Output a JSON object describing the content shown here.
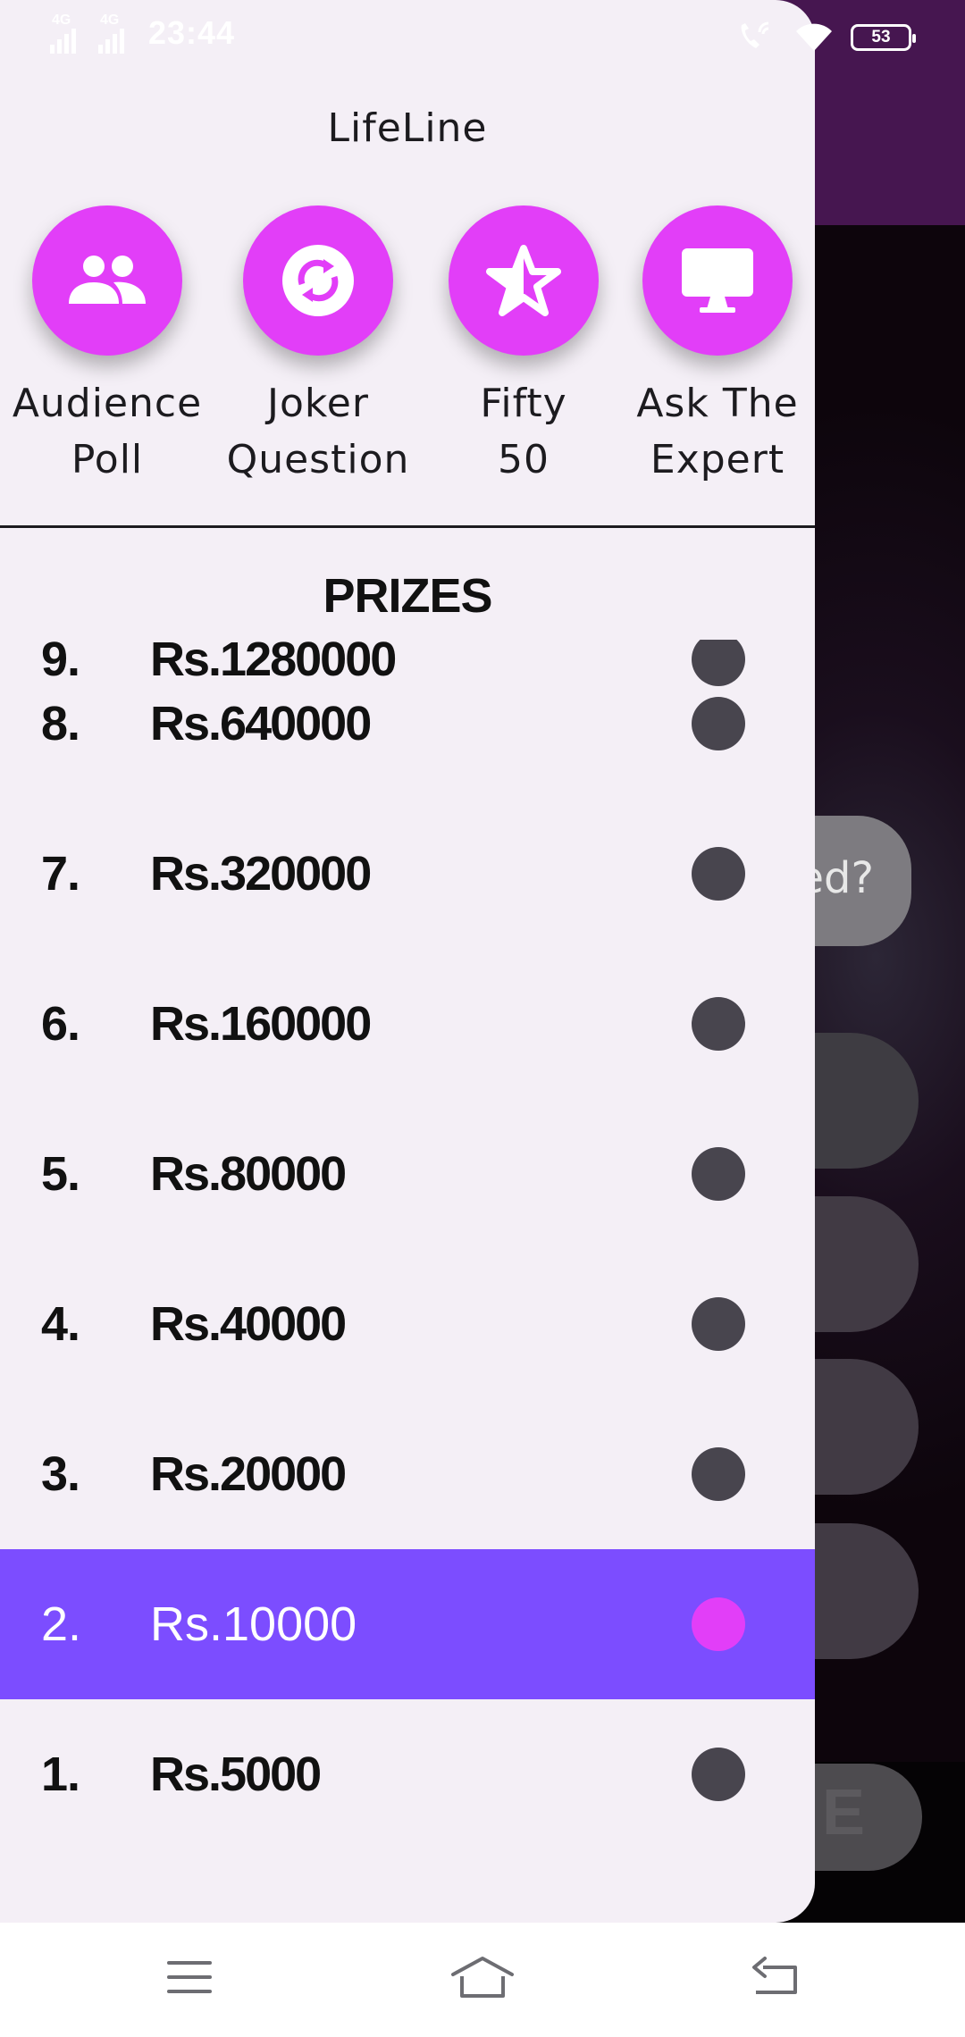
{
  "status_bar": {
    "network_1": "4G",
    "network_2": "4G",
    "time": "23:44",
    "battery": "53"
  },
  "background": {
    "question_fragment": "ed?",
    "action_fragment": "E"
  },
  "drawer": {
    "lifeline_title": "LifeLine",
    "lifelines": [
      {
        "line1": "Audience",
        "line2": "Poll",
        "icon": "group-icon"
      },
      {
        "line1": "Joker",
        "line2": "Question",
        "icon": "swap-icon"
      },
      {
        "line1": "Fifty",
        "line2": "50",
        "icon": "half-star-icon"
      },
      {
        "line1": "Ask The",
        "line2": "Expert",
        "icon": "monitor-icon"
      }
    ],
    "prizes_title": "PRIZES",
    "prizes": [
      {
        "num": "9.",
        "amount": "Rs.1280000"
      },
      {
        "num": "8.",
        "amount": "Rs.640000"
      },
      {
        "num": "7.",
        "amount": "Rs.320000"
      },
      {
        "num": "6.",
        "amount": "Rs.160000"
      },
      {
        "num": "5.",
        "amount": "Rs.80000"
      },
      {
        "num": "4.",
        "amount": "Rs.40000"
      },
      {
        "num": "3.",
        "amount": "Rs.20000"
      },
      {
        "num": "2.",
        "amount": "Rs.10000",
        "current": true
      },
      {
        "num": "1.",
        "amount": "Rs.5000"
      }
    ]
  },
  "colors": {
    "accent_magenta": "#e23ef8",
    "current_prize_highlight": "#7c4dff",
    "drawer_background": "#f4eff6",
    "app_header": "#461650"
  }
}
